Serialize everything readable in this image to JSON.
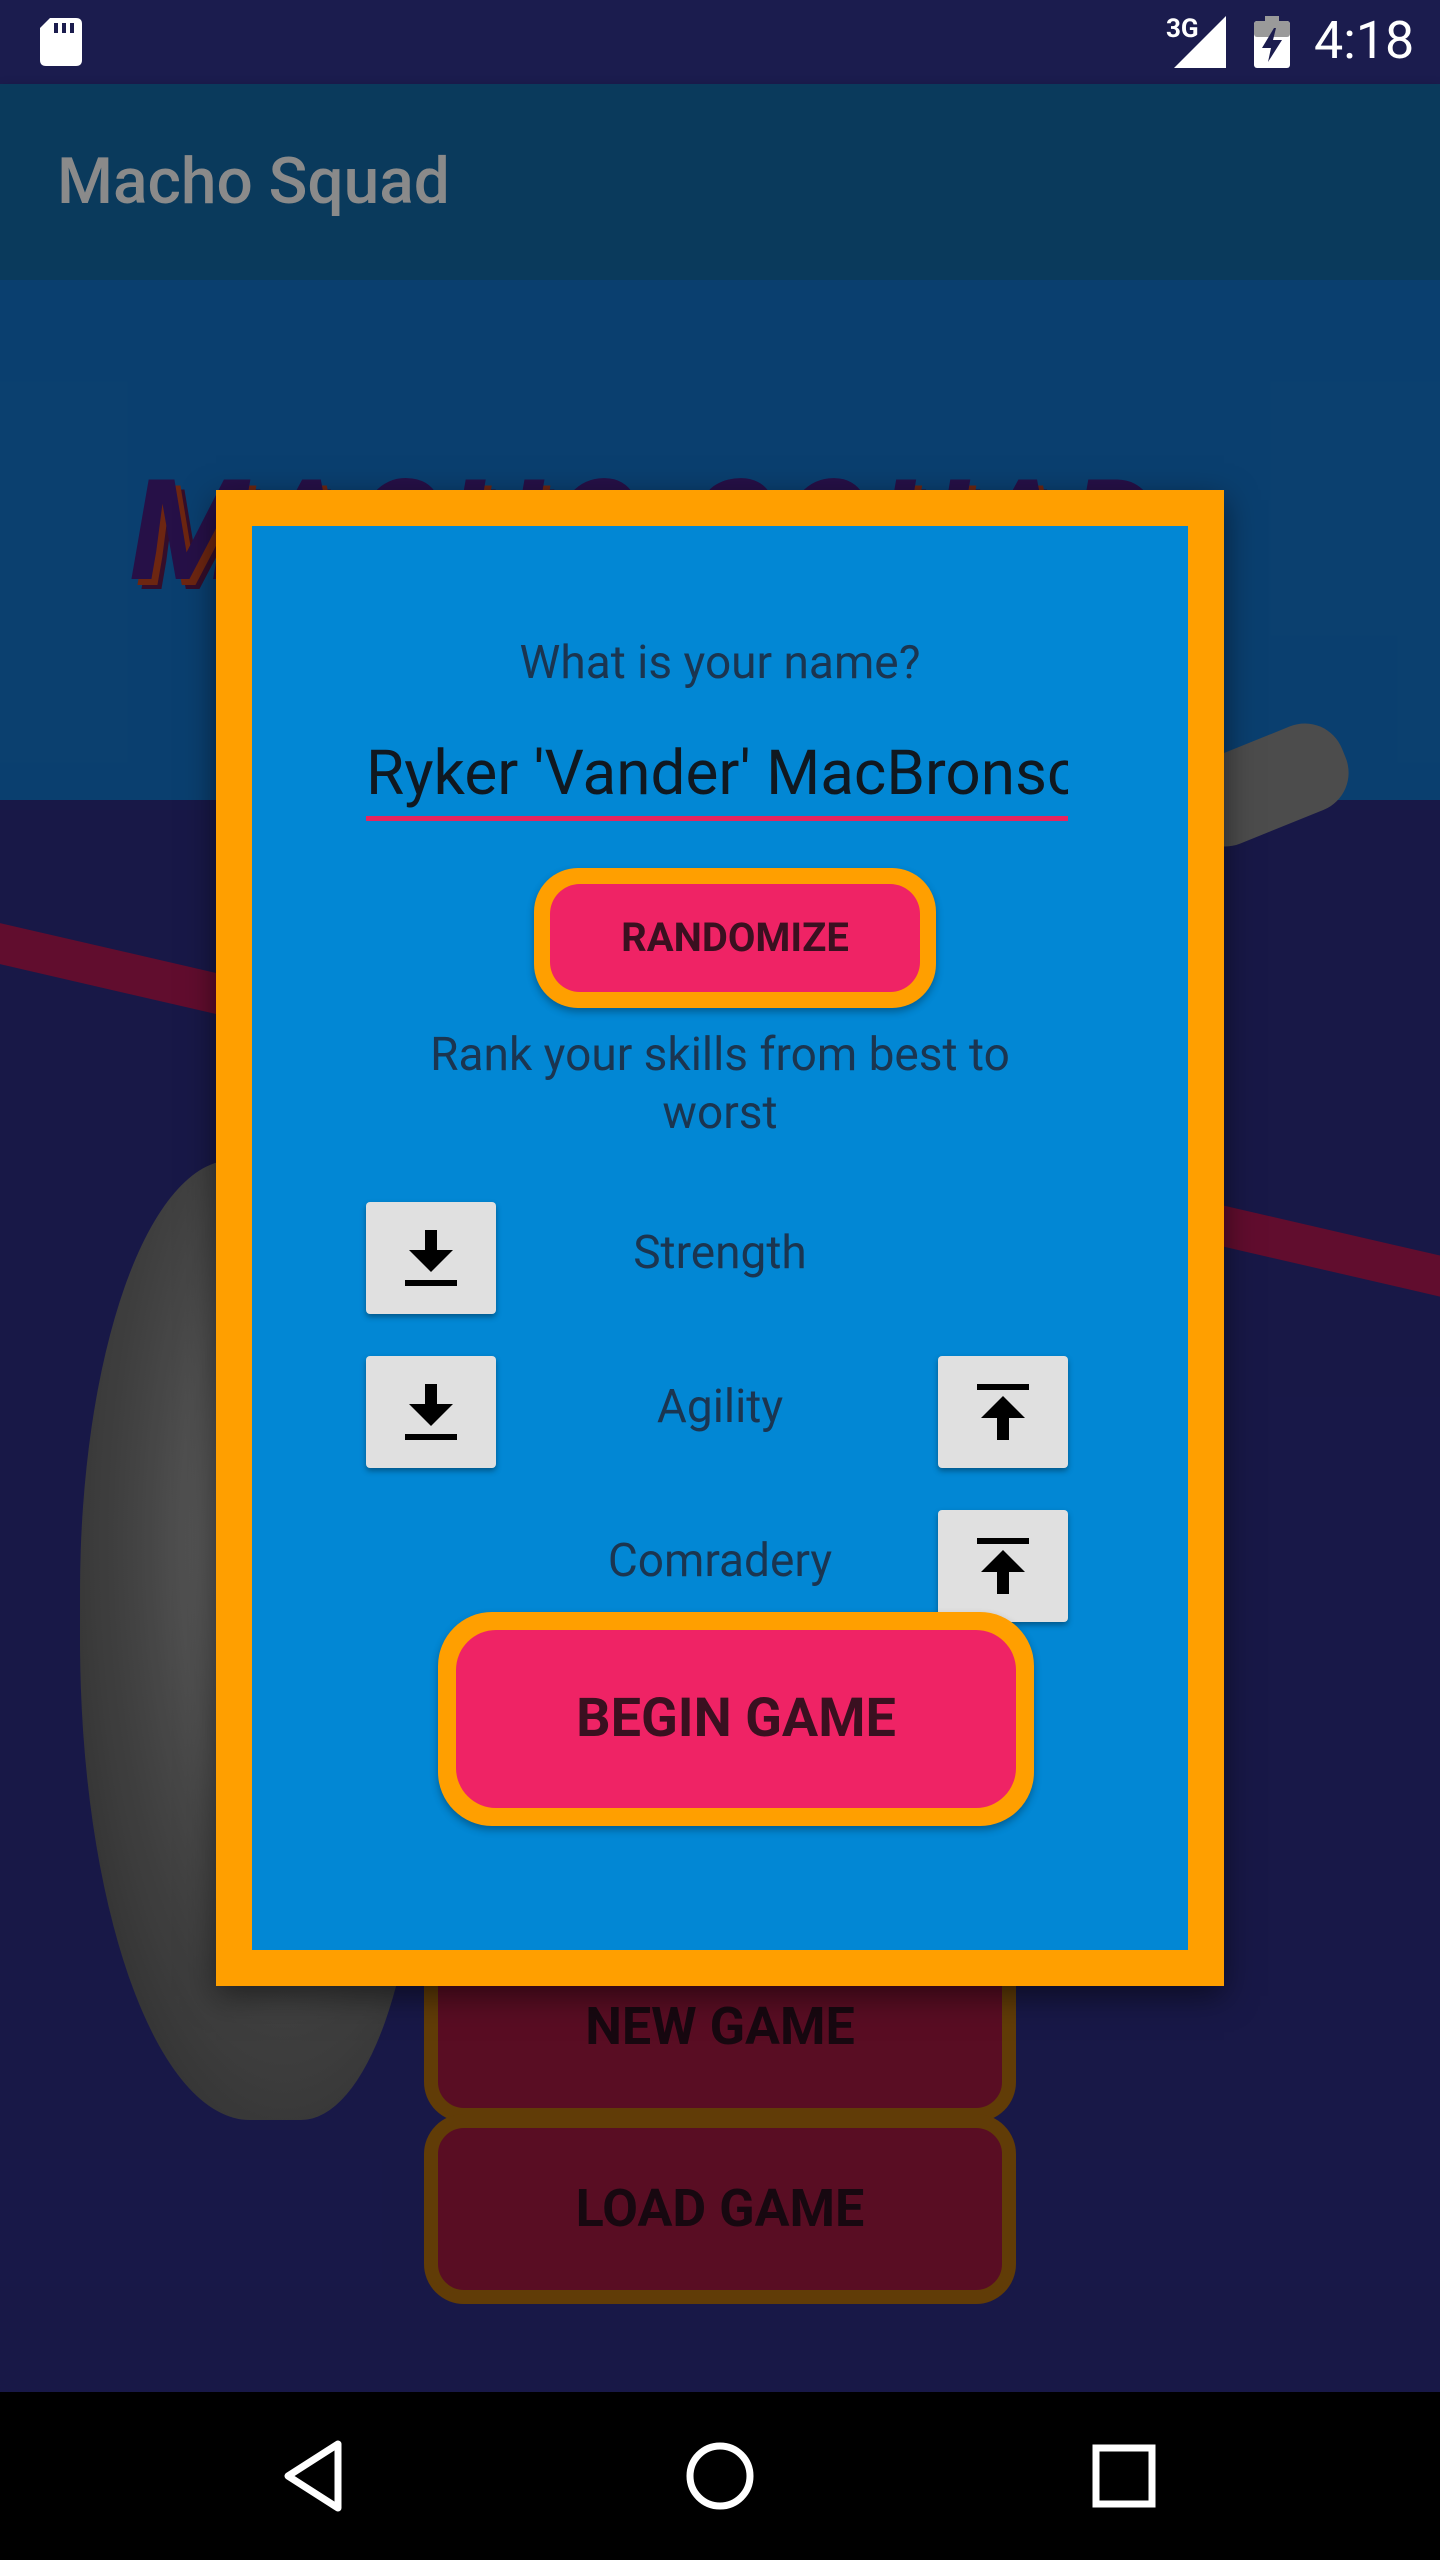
{
  "status_bar": {
    "network": "3G",
    "time": "4:18",
    "icons": [
      "sd-card-icon",
      "signal-icon",
      "battery-charging-icon"
    ]
  },
  "app_bar": {
    "title": "Macho Squad"
  },
  "background": {
    "logo_text": "MACHO SQUAD",
    "new_game_label": "NEW GAME",
    "load_game_label": "LOAD GAME"
  },
  "dialog": {
    "name_question": "What is your name?",
    "name_value": "Ryker 'Vander' MacBronsc",
    "randomize_label": "RANDOMIZE",
    "rank_prompt": "Rank your skills from best to worst",
    "skills": [
      {
        "label": "Strength",
        "move_down": true,
        "move_up": false
      },
      {
        "label": "Agility",
        "move_down": true,
        "move_up": true
      },
      {
        "label": "Comradery",
        "move_down": false,
        "move_up": true
      }
    ],
    "begin_label": "BEGIN GAME"
  },
  "nav_bar": {
    "icons": [
      "back-icon",
      "home-icon",
      "recents-icon"
    ]
  },
  "colors": {
    "accent_orange": "#ff9f00",
    "button_pink": "#ef2365",
    "dialog_blue": "#0287d4",
    "underline_pink": "#e8245e"
  }
}
